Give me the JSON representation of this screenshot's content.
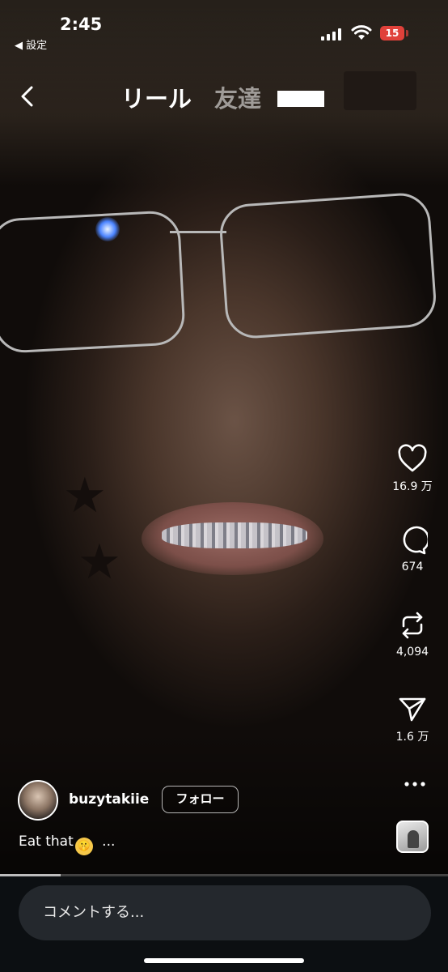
{
  "status_bar": {
    "time": "2:45",
    "back_app": "◀ 設定",
    "battery": "15"
  },
  "header": {
    "tab_reels": "リール",
    "tab_friends": "友達"
  },
  "actions": {
    "like_count": "16.9 万",
    "comment_count": "674",
    "repost_count": "4,094",
    "share_count": "1.6 万"
  },
  "author": {
    "username": "buzytakiie",
    "follow_label": "フォロー"
  },
  "caption": {
    "text": "Eat that",
    "emoji": "🤫",
    "more": "..."
  },
  "video": {
    "progress_fraction": 0.135
  },
  "comment_input": {
    "placeholder": "コメントする..."
  }
}
